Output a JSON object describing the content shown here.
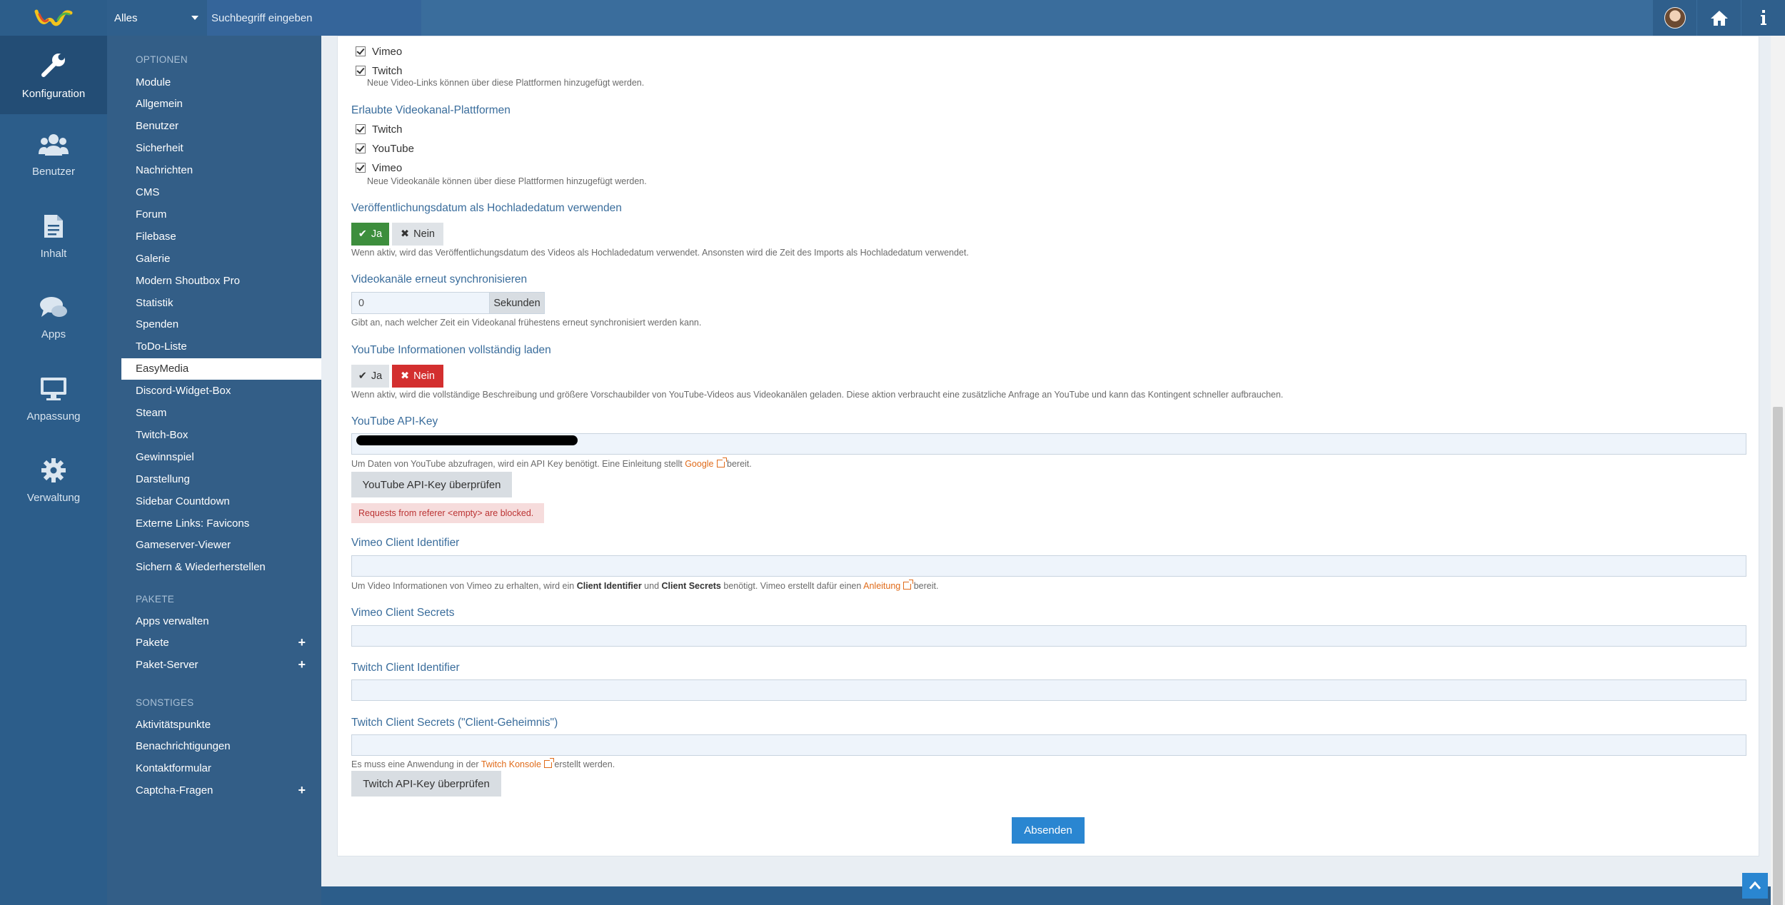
{
  "topbar": {
    "search_scope": "Alles",
    "search_placeholder": "Suchbegriff eingeben",
    "icons": [
      "avatar",
      "home-icon",
      "info-icon"
    ]
  },
  "rail": [
    {
      "label": "Konfiguration",
      "icon": "wrench-icon",
      "active": true
    },
    {
      "label": "Benutzer",
      "icon": "users-icon"
    },
    {
      "label": "Inhalt",
      "icon": "document-icon"
    },
    {
      "label": "Apps",
      "icon": "chat-icon"
    },
    {
      "label": "Anpassung",
      "icon": "monitor-icon"
    },
    {
      "label": "Verwaltung",
      "icon": "gear-icon"
    }
  ],
  "menu": {
    "head_optionen": "OPTIONEN",
    "optionen": [
      "Module",
      "Allgemein",
      "Benutzer",
      "Sicherheit",
      "Nachrichten",
      "CMS",
      "Forum",
      "Filebase",
      "Galerie",
      "Modern Shoutbox Pro",
      "Statistik",
      "Spenden",
      "ToDo-Liste",
      "EasyMedia",
      "Discord-Widget-Box",
      "Steam",
      "Twitch-Box",
      "Gewinnspiel",
      "Darstellung",
      "Sidebar Countdown",
      "Externe Links: Favicons",
      "Gameserver-Viewer",
      "Sichern & Wiederherstellen"
    ],
    "head_pakete": "PAKETE",
    "pakete": [
      "Apps verwalten",
      "Pakete",
      "Paket-Server"
    ],
    "head_sonstiges": "SONSTIGES",
    "sonstiges": [
      "Aktivitätspunkte",
      "Benachrichtigungen",
      "Kontaktformular",
      "Captcha-Fragen"
    ]
  },
  "form": {
    "video_platforms": {
      "items": [
        "Vimeo",
        "Twitch"
      ],
      "help": "Neue Video-Links können über diese Plattformen hinzugefügt werden."
    },
    "channel_platforms": {
      "title": "Erlaubte Videokanal-Plattformen",
      "items": [
        "Twitch",
        "YouTube",
        "Vimeo"
      ],
      "help": "Neue Videokanäle können über diese Plattformen hinzugefügt werden."
    },
    "publish_date": {
      "title": "Veröffentlichungsdatum als Hochladedatum verwenden",
      "yes": "Ja",
      "no": "Nein",
      "help": "Wenn aktiv, wird das Veröffentlichungsdatum des Videos als Hochladedatum verwendet. Ansonsten wird die Zeit des Imports als Hochladedatum verwendet."
    },
    "resync": {
      "title": "Videokanäle erneut synchronisieren",
      "value": "0",
      "unit": "Sekunden",
      "help": "Gibt an, nach welcher Zeit ein Videokanal frühestens erneut synchronisiert werden kann."
    },
    "yt_full": {
      "title": "YouTube Informationen vollständig laden",
      "yes": "Ja",
      "no": "Nein",
      "help": "Wenn aktiv, wird die vollständige Beschreibung und größere Vorschaubilder von YouTube-Videos aus Videokanälen geladen. Diese aktion verbraucht eine zusätzliche Anfrage an YouTube und kann das Kontingent schneller aufbrauchen."
    },
    "yt_key": {
      "title": "YouTube API-Key",
      "help_pre": "Um Daten von YouTube abzufragen, wird ein API Key benötigt. Eine Einleitung stellt",
      "help_link": "Google",
      "help_post": "bereit.",
      "check_button": "YouTube API-Key überprüfen",
      "error": "Requests from referer <empty> are blocked."
    },
    "vimeo_id": {
      "title": "Vimeo Client Identifier",
      "help_1": "Um Video Informationen von Vimeo zu erhalten, wird ein",
      "help_b1": "Client Identifier",
      "help_2": "und",
      "help_b2": "Client Secrets",
      "help_3": "benötigt. Vimeo erstellt dafür einen",
      "help_link": "Anleitung",
      "help_4": "bereit."
    },
    "vimeo_secret": {
      "title": "Vimeo Client Secrets"
    },
    "twitch_id": {
      "title": "Twitch Client Identifier"
    },
    "twitch_secret": {
      "title": "Twitch Client Secrets (\"Client-Geheimnis\")",
      "help_pre": "Es muss eine Anwendung in der",
      "help_link": "Twitch Konsole",
      "help_post": "erstellt werden.",
      "check_button": "Twitch API-Key überprüfen"
    },
    "submit": "Absenden"
  }
}
